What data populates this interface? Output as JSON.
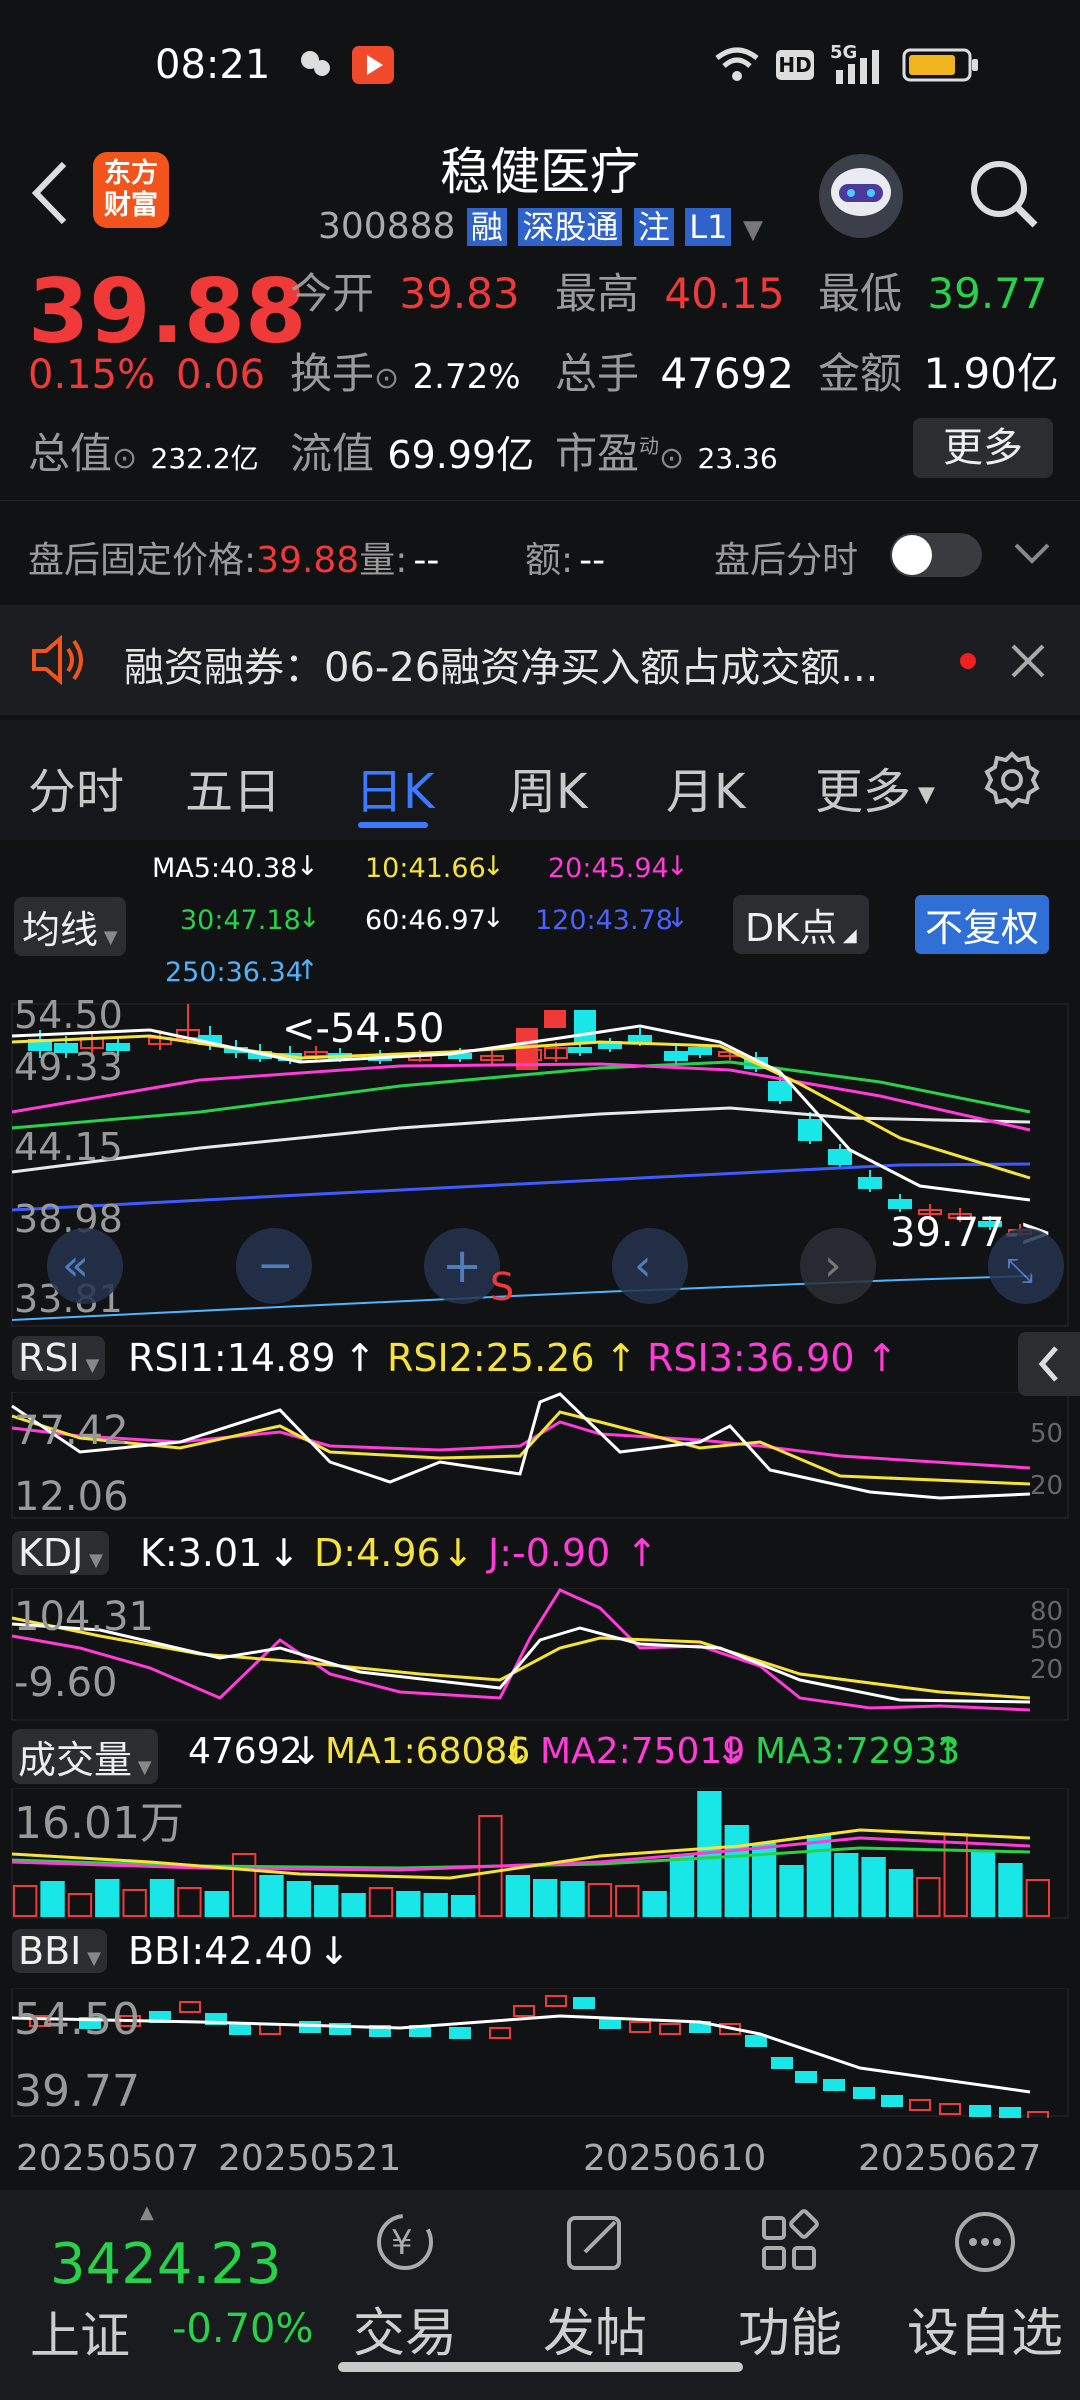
{
  "status_bar": {
    "time": "08:21",
    "network": "5G",
    "hd": "HD"
  },
  "header": {
    "title": "稳健医疗",
    "code": "300888",
    "badges": [
      "融",
      "深股通",
      "注",
      "L1"
    ],
    "logo_line1": "东方",
    "logo_line2": "财富"
  },
  "quote": {
    "price": "39.88",
    "change_pct": "0.15%",
    "change": "0.06",
    "open_label": "今开",
    "open": "39.83",
    "high_label": "最高",
    "high": "40.15",
    "low_label": "最低",
    "low": "39.77",
    "turnover_label": "换手",
    "turnover": "2.72%",
    "volume_label": "总手",
    "volume": "47692",
    "amount_label": "金额",
    "amount": "1.90亿",
    "mktcap_label": "总值",
    "mktcap": "232.2亿",
    "float_label": "流值",
    "float": "69.99亿",
    "pe_label": "市盈",
    "pe_sup": "动",
    "pe": "23.36",
    "more_button": "更多"
  },
  "after_hours": {
    "label": "盘后固定价格:",
    "price": "39.88",
    "vol_label": "量:",
    "vol": "--",
    "amt_label": "额:",
    "amt": "--",
    "toggle_label": "盘后分时",
    "toggle_on": false
  },
  "notice": {
    "text": "融资融券：06-26融资净买入额占成交额..."
  },
  "tabs": [
    "分时",
    "五日",
    "日K",
    "周K",
    "月K",
    "更多"
  ],
  "active_tab": "日K",
  "ma_legend": {
    "ma5": "MA5:40.38",
    "ma10": "10:41.66",
    "ma20": "20:45.94",
    "ma30": "30:47.18",
    "ma60": "60:46.97",
    "ma120": "120:43.78",
    "ma250": "250:36.34",
    "selector": "均线",
    "dk_button": "DK点",
    "adjust_button": "不复权"
  },
  "main_chart": {
    "y_labels": [
      "54.50",
      "49.33",
      "44.15",
      "38.98",
      "33.81"
    ],
    "high_marker": "<-54.50",
    "low_marker": "39.77->",
    "signal": "S"
  },
  "rsi": {
    "selector": "RSI",
    "rsi1": "RSI1:14.89",
    "rsi2": "RSI2:25.26",
    "rsi3": "RSI3:36.90",
    "y_labels": [
      "77.42",
      "12.06"
    ],
    "levels": [
      "50",
      "20"
    ]
  },
  "kdj": {
    "selector": "KDJ",
    "k": "K:3.01",
    "d": "D:4.96",
    "j": "J:-0.90",
    "y_labels": [
      "104.31",
      "-9.60"
    ],
    "levels": [
      "80",
      "50",
      "20"
    ]
  },
  "volume": {
    "selector": "成交量",
    "value": "47692",
    "ma1": "MA1:68086",
    "ma2": "MA2:75019",
    "ma3": "MA3:72933",
    "y_label": "16.01万"
  },
  "bbi": {
    "selector": "BBI",
    "value": "BBI:42.40",
    "y_labels": [
      "54.50",
      "39.77"
    ]
  },
  "dates": [
    "20250507",
    "20250521",
    "20250610",
    "20250627"
  ],
  "bottom_nav": {
    "index_value": "3424.23",
    "index_name": "上证",
    "index_change": "-0.70%",
    "items": [
      "交易",
      "发帖",
      "功能",
      "设自选"
    ]
  },
  "colors": {
    "up": "#f03a3a",
    "down": "#19e6e6",
    "accent": "#3b7bff",
    "bg": "#111214"
  }
}
